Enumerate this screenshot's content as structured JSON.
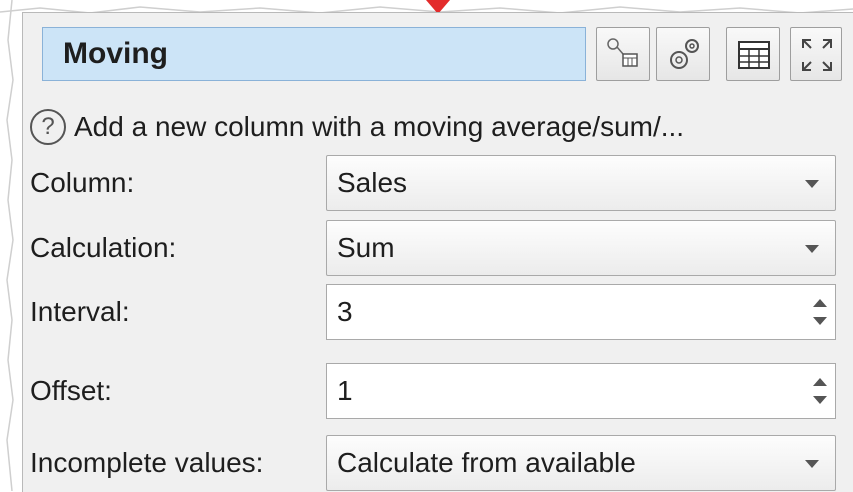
{
  "node": {
    "name_value": "Moving",
    "toolbar_icons": [
      "node-calc-icon",
      "gear-icon",
      "table-icon",
      "expand-icon"
    ]
  },
  "help": {
    "icon": "help-icon",
    "text": "Add a new column with a moving average/sum/..."
  },
  "fields": {
    "column": {
      "label": "Column:",
      "value": "Sales"
    },
    "calculation": {
      "label": "Calculation:",
      "value": "Sum"
    },
    "interval": {
      "label": "Interval:",
      "value": "3"
    },
    "offset": {
      "label": "Offset:",
      "value": "1"
    },
    "incomplete": {
      "label": "Incomplete values:",
      "value": "Calculate from available"
    }
  },
  "colors": {
    "name_field_bg": "#cce4f7",
    "pointer": "#e32b2b"
  }
}
